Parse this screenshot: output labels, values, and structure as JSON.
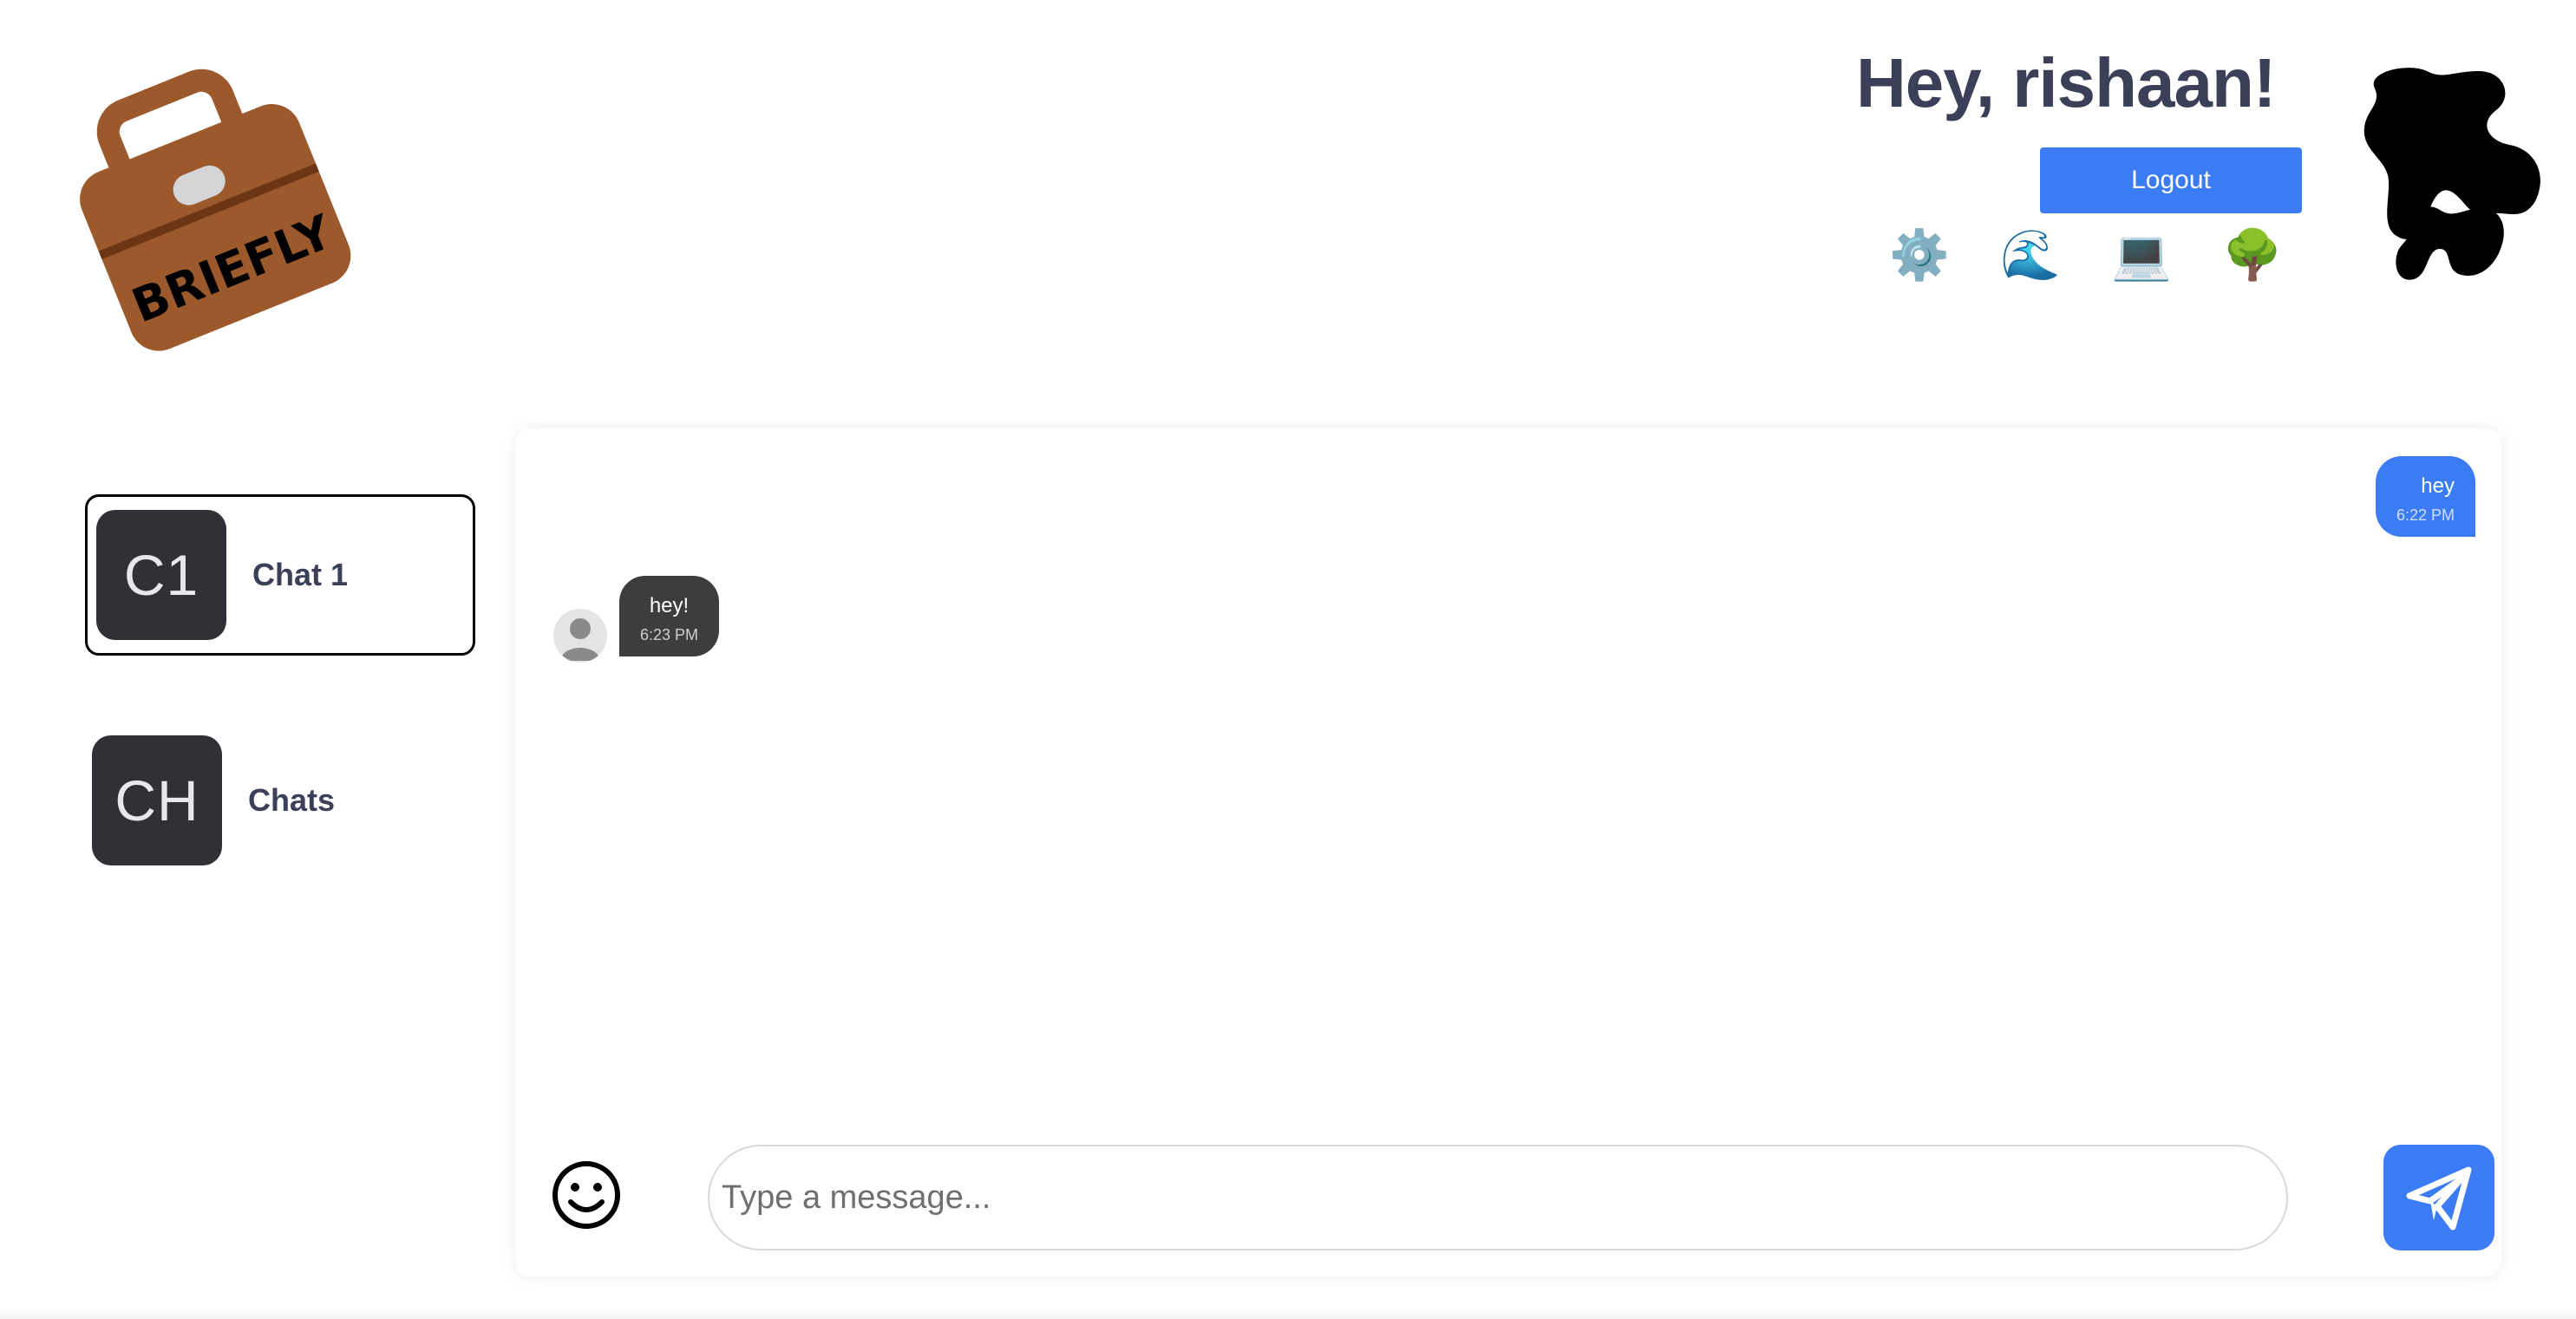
{
  "brand": {
    "logo_text": "BRIEFLY",
    "logo_icon": "briefcase-logo-icon",
    "mark_icon": "rtm-monogram-icon"
  },
  "header": {
    "greeting": "Hey, rishaan!",
    "logout_label": "Logout",
    "theme_emojis": [
      {
        "glyph": "⚙️",
        "icon": "gear-icon"
      },
      {
        "glyph": "🌊",
        "icon": "wave-icon"
      },
      {
        "glyph": "💻",
        "icon": "laptop-icon"
      },
      {
        "glyph": "🌳",
        "icon": "tree-icon"
      }
    ]
  },
  "sidebar": {
    "chats": [
      {
        "initials": "C1",
        "label": "Chat 1",
        "active": true
      },
      {
        "initials": "CH",
        "label": "Chats",
        "active": false
      }
    ]
  },
  "conversation": {
    "messages": [
      {
        "direction": "outgoing",
        "text": "hey",
        "time": "6:22 PM"
      },
      {
        "direction": "incoming",
        "text": "hey!",
        "time": "6:23 PM"
      }
    ]
  },
  "composer": {
    "placeholder": "Type a message...",
    "value": "",
    "emoji_icon": "smiley-icon",
    "send_icon": "paper-plane-icon"
  },
  "colors": {
    "accent": "#3b7cf4",
    "heading": "#3c3f58",
    "tile": "#303136",
    "incoming_bubble": "#3d3d3f",
    "logo_brown": "#9c5a2c"
  }
}
